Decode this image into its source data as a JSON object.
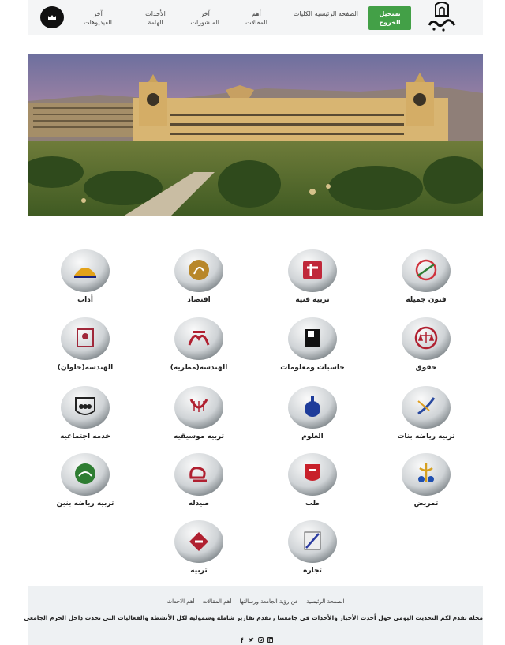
{
  "header": {
    "logout": "تسجيل الخروج",
    "nav": [
      "الصفحة الرئيسية",
      "الكليات",
      "أهم المقالات",
      "آخر المنشورات",
      "الأحداث الهامة",
      "آخر الفيديوهات"
    ]
  },
  "colleges": [
    {
      "label": "فنون جميله",
      "icon": "fine-arts-icon"
    },
    {
      "label": "تربيه فنيه",
      "icon": "art-education-icon"
    },
    {
      "label": "اقتصاد",
      "icon": "economics-icon"
    },
    {
      "label": "أداب",
      "icon": "arts-icon"
    },
    {
      "label": "حقوق",
      "icon": "law-scales-icon"
    },
    {
      "label": "حاسبات ومعلومات",
      "icon": "computers-icon"
    },
    {
      "label": "الهندسه(مطريه)",
      "icon": "engineering-mataria-icon"
    },
    {
      "label": "الهندسه(حلوان)",
      "icon": "engineering-helwan-icon"
    },
    {
      "label": "تربيه رياضه بنات",
      "icon": "sports-girls-icon"
    },
    {
      "label": "العلوم",
      "icon": "science-flask-icon"
    },
    {
      "label": "تربيه موسيقيه",
      "icon": "music-lyre-icon"
    },
    {
      "label": "خدمه اجتماعيه",
      "icon": "social-work-icon"
    },
    {
      "label": "تمريض",
      "icon": "nursing-icon"
    },
    {
      "label": "طب",
      "icon": "medicine-icon"
    },
    {
      "label": "صيدله",
      "icon": "pharmacy-icon"
    },
    {
      "label": "تربيه رياضه بنين",
      "icon": "sports-boys-icon"
    },
    {
      "label": "تجاره",
      "icon": "commerce-icon"
    },
    {
      "label": "تربيه",
      "icon": "education-icon"
    }
  ],
  "footer": {
    "links": [
      "الصفحة الرئيسية",
      "عن رؤية الجامعة ورسالتها",
      "أهم المقالات",
      "أهم الاحداث"
    ],
    "description": "مجلة تقدم لكم التحديث اليومي حول أحدث الأخبار والأحداث في جامعتنا , تقدم تقارير شاملة وشمولية لكل الأنشطة والفعاليات التي تحدث داخل الحرم الجامعي",
    "socials": [
      "linkedin-icon",
      "instagram-icon",
      "twitter-icon",
      "facebook-icon"
    ]
  },
  "colors": {
    "accent": "#43a047",
    "header_bg": "#f4f5f6",
    "footer_bg": "#eef1f3"
  }
}
